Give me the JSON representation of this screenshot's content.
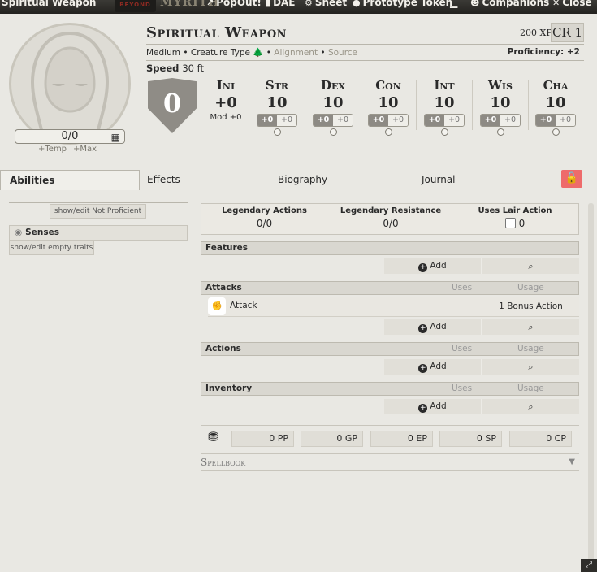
{
  "titlebar": {
    "title": "Spiritual Weapon",
    "ddb_label": "BEYOND",
    "myrith": "MYRITH",
    "buttons": [
      "PopOut!",
      "DAE",
      "Sheet",
      "Prototype Token",
      "Companions",
      "Close"
    ]
  },
  "portrait": {
    "hp": "0/0",
    "temp_label": "+Temp",
    "max_label": "+Max"
  },
  "header": {
    "name": "Spiritual Weapon",
    "xp": "200 XP",
    "cr": "CR 1",
    "size": "Medium",
    "creature_type": "Creature Type",
    "alignment": "Alignment",
    "source": "Source",
    "proficiency": "Proficiency: +2",
    "speed_label": "Speed",
    "speed_value": "30 ft"
  },
  "ac": "0",
  "initiative": {
    "label": "Ini",
    "value": "+0",
    "mod": "Mod +0"
  },
  "abilities": [
    {
      "label": "Str",
      "score": "10",
      "mod": "+0",
      "save": "+0"
    },
    {
      "label": "Dex",
      "score": "10",
      "mod": "+0",
      "save": "+0"
    },
    {
      "label": "Con",
      "score": "10",
      "mod": "+0",
      "save": "+0"
    },
    {
      "label": "Int",
      "score": "10",
      "mod": "+0",
      "save": "+0"
    },
    {
      "label": "Wis",
      "score": "10",
      "mod": "+0",
      "save": "+0"
    },
    {
      "label": "Cha",
      "score": "10",
      "mod": "+0",
      "save": "+0"
    }
  ],
  "tabs": [
    "Abilities",
    "Effects",
    "Biography",
    "Journal"
  ],
  "left": {
    "not_proficient": "show/edit Not Proficient",
    "senses": "Senses",
    "empty_traits": "show/edit empty traits"
  },
  "legendary": {
    "actions_label": "Legendary Actions",
    "actions_value": "0/0",
    "resistance_label": "Legendary Resistance",
    "resistance_value": "0/0",
    "lair_label": "Uses Lair Action",
    "lair_value": "0"
  },
  "sections": {
    "features": "Features",
    "attacks": "Attacks",
    "actions": "Actions",
    "inventory": "Inventory",
    "uses": "Uses",
    "usage": "Usage",
    "add": "Add"
  },
  "attack_item": {
    "name": "Attack",
    "usage": "1 Bonus Action"
  },
  "currency": [
    "0 PP",
    "0 GP",
    "0 EP",
    "0 SP",
    "0 CP"
  ],
  "spellbook": "Spellbook"
}
